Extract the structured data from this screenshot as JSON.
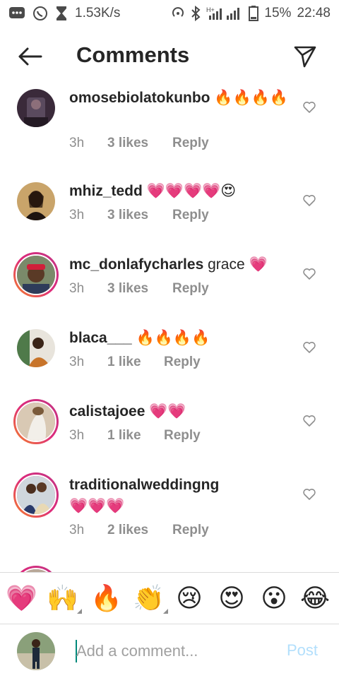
{
  "status_bar": {
    "speed": "1.53K/s",
    "battery": "15%",
    "time": "22:48",
    "icons": [
      "message-icon",
      "whatsapp-icon",
      "hourglass-icon",
      "hotspot-icon",
      "bluetooth-icon",
      "signal-icon",
      "battery-icon"
    ]
  },
  "header": {
    "title": "Comments",
    "back_icon": "arrow-left-icon",
    "share_icon": "send-icon"
  },
  "comments": [
    {
      "username": "omosebiolatokunbo",
      "text": "🔥🔥🔥🔥",
      "time": "3h",
      "likes": "3 likes",
      "reply": "Reply",
      "story_ring": false
    },
    {
      "username": "mhiz_tedd",
      "text": "💗💗💗💗😍",
      "time": "3h",
      "likes": "3 likes",
      "reply": "Reply",
      "story_ring": false
    },
    {
      "username": "mc_donlafycharles",
      "text": "grace 💗",
      "time": "3h",
      "likes": "3 likes",
      "reply": "Reply",
      "story_ring": true
    },
    {
      "username": "blaca___",
      "text": "🔥🔥🔥🔥",
      "time": "3h",
      "likes": "1 like",
      "reply": "Reply",
      "story_ring": false
    },
    {
      "username": "calistajoee",
      "text": "💗💗",
      "time": "3h",
      "likes": "1 like",
      "reply": "Reply",
      "story_ring": true
    },
    {
      "username": "traditionalweddingng",
      "text": "💗💗💗",
      "time": "3h",
      "likes": "2 likes",
      "reply": "Reply",
      "story_ring": true
    }
  ],
  "emoji_bar": [
    "💗",
    "🙌",
    "🔥",
    "👏",
    "😢",
    "😍",
    "😮",
    "😂"
  ],
  "composer": {
    "placeholder": "Add a comment...",
    "post_label": "Post"
  },
  "colors": {
    "text": "#262626",
    "muted": "#8e8e8e",
    "post_disabled": "#b2dffc",
    "story_ring_start": "#f58529",
    "story_ring_end": "#c13584"
  }
}
